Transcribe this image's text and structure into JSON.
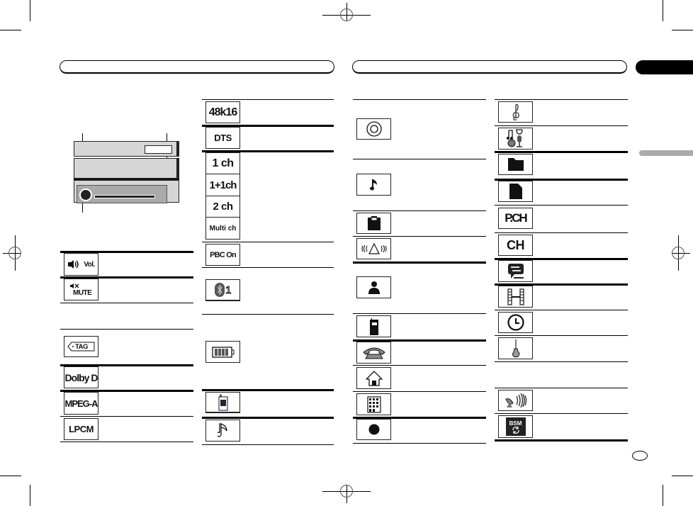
{
  "page": {
    "left_header_pill": "",
    "right_header_pill": "",
    "section_tab": "",
    "page_number": ""
  },
  "column1": {
    "display_diagram": {
      "description": "unit display diagram",
      "callouts": [
        "",
        "",
        ""
      ]
    },
    "items": [
      {
        "icon": "volume-icon",
        "label": "Vol."
      },
      {
        "icon": "mute-icon",
        "label": "MUTE"
      },
      {
        "icon": "tag-icon",
        "label": "TAG"
      },
      {
        "icon": "dolby-d-icon",
        "label": "Dolby D"
      },
      {
        "icon": "mpeg-a-icon",
        "label": "MPEG-A"
      },
      {
        "icon": "lpcm-icon",
        "label": "LPCM"
      }
    ]
  },
  "column2": {
    "items": [
      {
        "icon": "sampling-rate-icon",
        "label": "48k16"
      },
      {
        "icon": "dts-icon",
        "label": "DTS"
      },
      {
        "icon": "channel-1ch-icon",
        "label": "1 ch"
      },
      {
        "icon": "channel-1plus1ch-icon",
        "label": "1+1ch"
      },
      {
        "icon": "channel-2ch-icon",
        "label": "2 ch"
      },
      {
        "icon": "channel-multi-icon",
        "label": "Multi ch"
      },
      {
        "icon": "pbc-on-icon",
        "label": "PBC On"
      },
      {
        "icon": "bluetooth-icon",
        "label": "1"
      },
      {
        "icon": "battery-icon",
        "label": ""
      },
      {
        "icon": "phone-signal-icon",
        "label": ""
      },
      {
        "icon": "music-note-outline-icon",
        "label": ""
      }
    ]
  },
  "column3": {
    "items": [
      {
        "icon": "disc-icon"
      },
      {
        "icon": "music-note-icon"
      },
      {
        "icon": "memory-card-icon"
      },
      {
        "icon": "vibration-alert-icon"
      },
      {
        "icon": "person-icon"
      },
      {
        "icon": "mobile-phone-icon"
      },
      {
        "icon": "telephone-icon"
      },
      {
        "icon": "home-icon"
      },
      {
        "icon": "office-building-icon"
      },
      {
        "icon": "record-dot-icon"
      }
    ]
  },
  "column4": {
    "items": [
      {
        "icon": "treble-clef-icon",
        "label": ""
      },
      {
        "icon": "genre-icon",
        "label": ""
      },
      {
        "icon": "folder-icon",
        "label": ""
      },
      {
        "icon": "file-icon",
        "label": ""
      },
      {
        "icon": "preset-channel-icon",
        "label": "P.CH"
      },
      {
        "icon": "channel-icon",
        "label": "CH"
      },
      {
        "icon": "message-icon",
        "label": ""
      },
      {
        "icon": "film-icon",
        "label": ""
      },
      {
        "icon": "clock-icon",
        "label": ""
      },
      {
        "icon": "guitar-icon",
        "label": ""
      },
      {
        "icon": "satellite-icon",
        "label": ""
      },
      {
        "icon": "bsm-icon",
        "label": "BSM"
      }
    ]
  }
}
